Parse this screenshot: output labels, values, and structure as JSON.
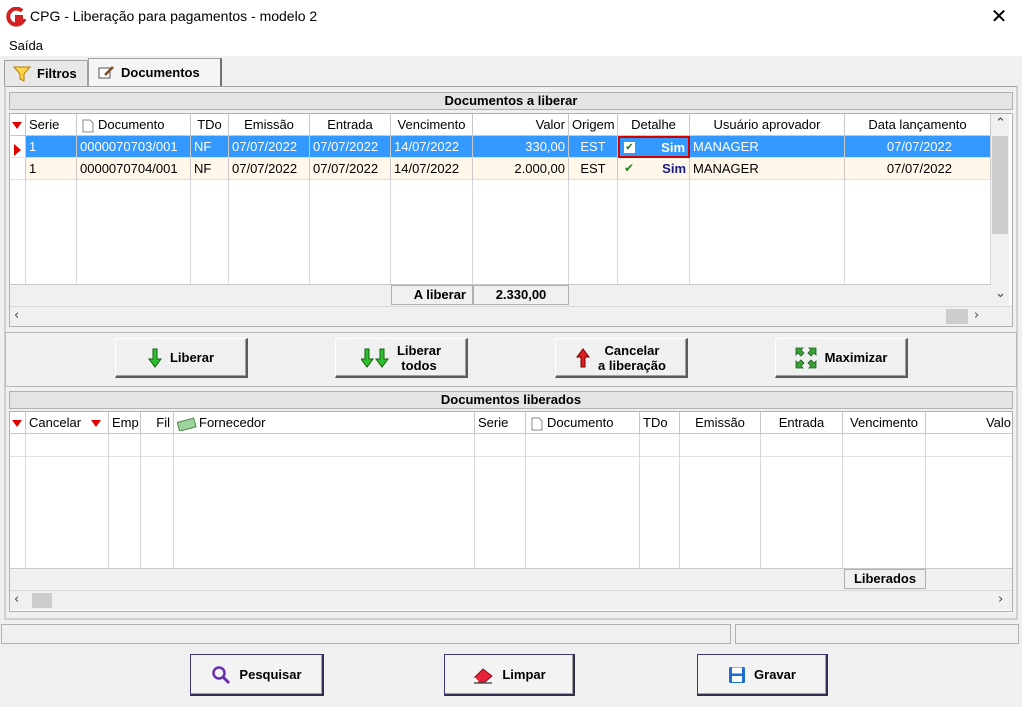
{
  "window": {
    "title": "CPG - Liberação para pagamentos - modelo 2",
    "close_glyph": "✕"
  },
  "menu": {
    "saida": "Saída"
  },
  "tabs": [
    {
      "label": "Filtros"
    },
    {
      "label": "Documentos"
    }
  ],
  "pending": {
    "header": "Documentos a liberar",
    "columns": [
      "Serie",
      "Documento",
      "TDo",
      "Emissão",
      "Entrada",
      "Vencimento",
      "Valor",
      "Origem",
      "Detalhe",
      "Usuário aprovador",
      "Data lançamento"
    ],
    "rows": [
      {
        "serie": "1",
        "documento": "0000070703/001",
        "tdo": "NF",
        "emissao": "07/07/2022",
        "entrada": "07/07/2022",
        "vencimento": "14/07/2022",
        "valor": "330,00",
        "origem": "EST",
        "detalhe": "Sim",
        "usuario": "MANAGER",
        "data_lancamento": "07/07/2022"
      },
      {
        "serie": "1",
        "documento": "0000070704/001",
        "tdo": "NF",
        "emissao": "07/07/2022",
        "entrada": "07/07/2022",
        "vencimento": "14/07/2022",
        "valor": "2.000,00",
        "origem": "EST",
        "detalhe": "Sim",
        "usuario": "MANAGER",
        "data_lancamento": "07/07/2022"
      }
    ],
    "total_label": "A liberar",
    "total_value": "2.330,00"
  },
  "actions": {
    "liberar": "Liberar",
    "liberar_todos_1": "Liberar",
    "liberar_todos_2": "todos",
    "cancelar_1": "Cancelar",
    "cancelar_2": "a liberação",
    "maximizar": "Maximizar"
  },
  "released": {
    "header": "Documentos liberados",
    "columns": [
      "Cancelar",
      "Emp",
      "Fil",
      "Fornecedor",
      "Serie",
      "Documento",
      "TDo",
      "Emissão",
      "Entrada",
      "Vencimento",
      "Valo"
    ],
    "total_label": "Liberados"
  },
  "bottom": {
    "pesquisar": "Pesquisar",
    "limpar": "Limpar",
    "gravar": "Gravar"
  },
  "colors": {
    "selection": "#3399ff",
    "accent_red": "#e00000",
    "highlight_box": "#d00000"
  }
}
